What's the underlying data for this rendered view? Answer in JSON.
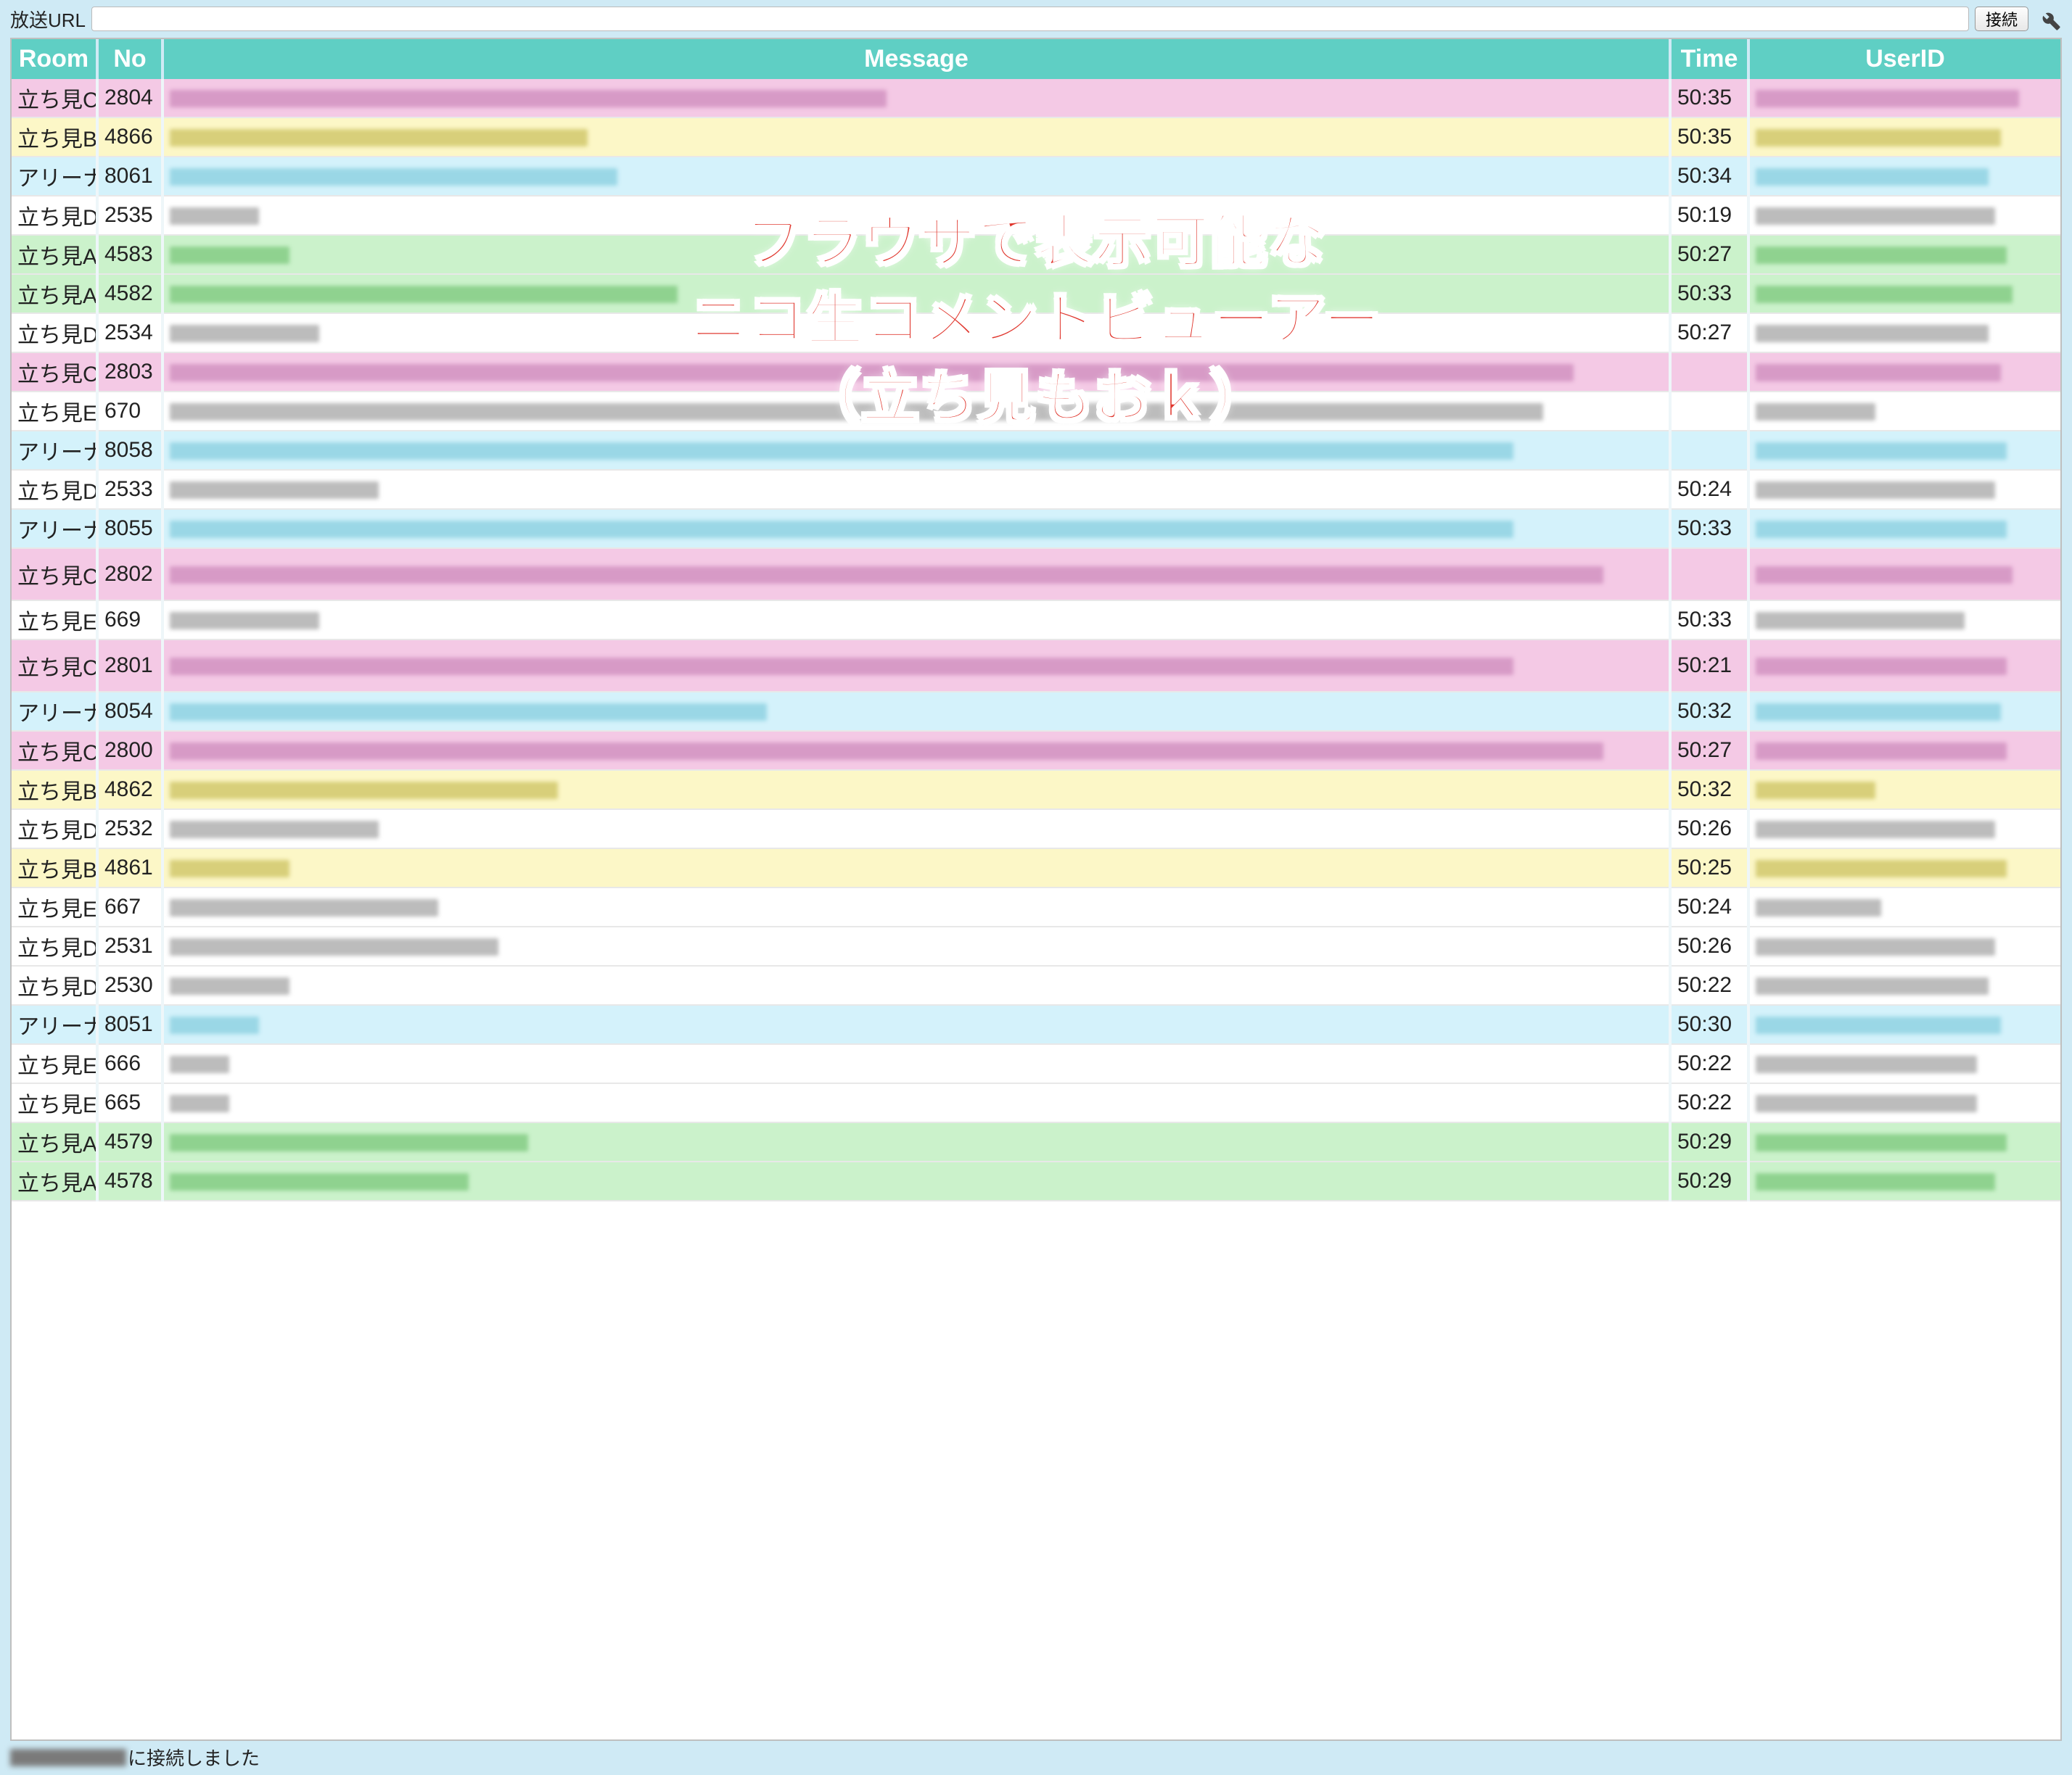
{
  "topbar": {
    "label": "放送URL",
    "url_value": "",
    "connect_label": "接続"
  },
  "columns": {
    "room": "Room",
    "no": "No",
    "message": "Message",
    "time": "Time",
    "userid": "UserID"
  },
  "room_classes": {
    "アリーナ": "room-arena",
    "立ち見A": "room-a",
    "立ち見B": "room-b",
    "立ち見C": "room-c",
    "立ち見D": "room-d",
    "立ち見E": "room-e"
  },
  "rows": [
    {
      "room": "立ち見C",
      "no": "2804",
      "time": "50:35",
      "msg_w": 48,
      "uid_w": 88
    },
    {
      "room": "立ち見B",
      "no": "4866",
      "time": "50:35",
      "msg_w": 28,
      "uid_w": 82
    },
    {
      "room": "アリーナ",
      "no": "8061",
      "time": "50:34",
      "msg_w": 30,
      "uid_w": 78
    },
    {
      "room": "立ち見D",
      "no": "2535",
      "time": "50:19",
      "msg_w": 6,
      "uid_w": 80
    },
    {
      "room": "立ち見A",
      "no": "4583",
      "time": "50:27",
      "msg_w": 8,
      "uid_w": 84
    },
    {
      "room": "立ち見A",
      "no": "4582",
      "time": "50:33",
      "msg_w": 34,
      "uid_w": 86
    },
    {
      "room": "立ち見D",
      "no": "2534",
      "time": "50:27",
      "msg_w": 10,
      "uid_w": 78
    },
    {
      "room": "立ち見C",
      "no": "2803",
      "time": "",
      "msg_w": 94,
      "uid_w": 82
    },
    {
      "room": "立ち見E",
      "no": "670",
      "time": "",
      "msg_w": 92,
      "uid_w": 40
    },
    {
      "room": "アリーナ",
      "no": "8058",
      "time": "",
      "msg_w": 90,
      "uid_w": 84
    },
    {
      "room": "立ち見D",
      "no": "2533",
      "time": "50:24",
      "msg_w": 14,
      "uid_w": 80
    },
    {
      "room": "アリーナ",
      "no": "8055",
      "time": "50:33",
      "msg_w": 90,
      "uid_w": 84
    },
    {
      "room": "立ち見C",
      "no": "2802",
      "time": "",
      "msg_w": 96,
      "uid_w": 86,
      "tall": true
    },
    {
      "room": "立ち見E",
      "no": "669",
      "time": "50:33",
      "msg_w": 10,
      "uid_w": 70
    },
    {
      "room": "立ち見C",
      "no": "2801",
      "time": "50:21",
      "msg_w": 90,
      "uid_w": 84,
      "tall": true
    },
    {
      "room": "アリーナ",
      "no": "8054",
      "time": "50:32",
      "msg_w": 40,
      "uid_w": 82
    },
    {
      "room": "立ち見C",
      "no": "2800",
      "time": "50:27",
      "msg_w": 96,
      "uid_w": 84
    },
    {
      "room": "立ち見B",
      "no": "4862",
      "time": "50:32",
      "msg_w": 26,
      "uid_w": 40
    },
    {
      "room": "立ち見D",
      "no": "2532",
      "time": "50:26",
      "msg_w": 14,
      "uid_w": 80
    },
    {
      "room": "立ち見B",
      "no": "4861",
      "time": "50:25",
      "msg_w": 8,
      "uid_w": 84
    },
    {
      "room": "立ち見E",
      "no": "667",
      "time": "50:24",
      "msg_w": 18,
      "uid_w": 42
    },
    {
      "room": "立ち見D",
      "no": "2531",
      "time": "50:26",
      "msg_w": 22,
      "uid_w": 80
    },
    {
      "room": "立ち見D",
      "no": "2530",
      "time": "50:22",
      "msg_w": 8,
      "uid_w": 78
    },
    {
      "room": "アリーナ",
      "no": "8051",
      "time": "50:30",
      "msg_w": 6,
      "uid_w": 82
    },
    {
      "room": "立ち見E",
      "no": "666",
      "time": "50:22",
      "msg_w": 4,
      "uid_w": 74
    },
    {
      "room": "立ち見E",
      "no": "665",
      "time": "50:22",
      "msg_w": 4,
      "uid_w": 74
    },
    {
      "room": "立ち見A",
      "no": "4579",
      "time": "50:29",
      "msg_w": 24,
      "uid_w": 84
    },
    {
      "room": "立ち見A",
      "no": "4578",
      "time": "50:29",
      "msg_w": 20,
      "uid_w": 80
    }
  ],
  "status": {
    "suffix": "に接続しました"
  },
  "overlay": {
    "line1": "ブラウザで表示可能な",
    "line2": "ニコ生コメントビューアー",
    "line3": "（立ち見もおｋ）"
  },
  "blur_palettes": {
    "アリーナ": "#9ad7e6",
    "立ち見A": "#8fd28f",
    "立ち見B": "#d8cf7a",
    "立ち見C": "#d79ac6",
    "立ち見D": "#bcbcbc",
    "立ち見E": "#bcbcbc"
  }
}
